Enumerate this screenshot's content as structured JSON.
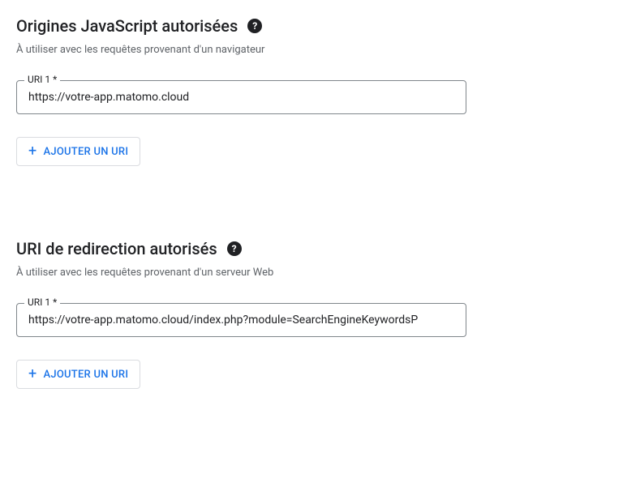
{
  "sections": {
    "jsOrigins": {
      "title": "Origines JavaScript autorisées",
      "subtitle": "À utiliser avec les requêtes provenant d'un navigateur",
      "input": {
        "label": "URI 1 *",
        "value": "https://votre-app.matomo.cloud"
      },
      "addButton": "AJOUTER UN URI"
    },
    "redirectUris": {
      "title": "URI de redirection autorisés",
      "subtitle": "À utiliser avec les requêtes provenant d'un serveur Web",
      "input": {
        "label": "URI 1 *",
        "value": "https://votre-app.matomo.cloud/index.php?module=SearchEngineKeywordsP"
      },
      "addButton": "AJOUTER UN URI"
    }
  },
  "icons": {
    "help": "?",
    "plus": "+"
  }
}
